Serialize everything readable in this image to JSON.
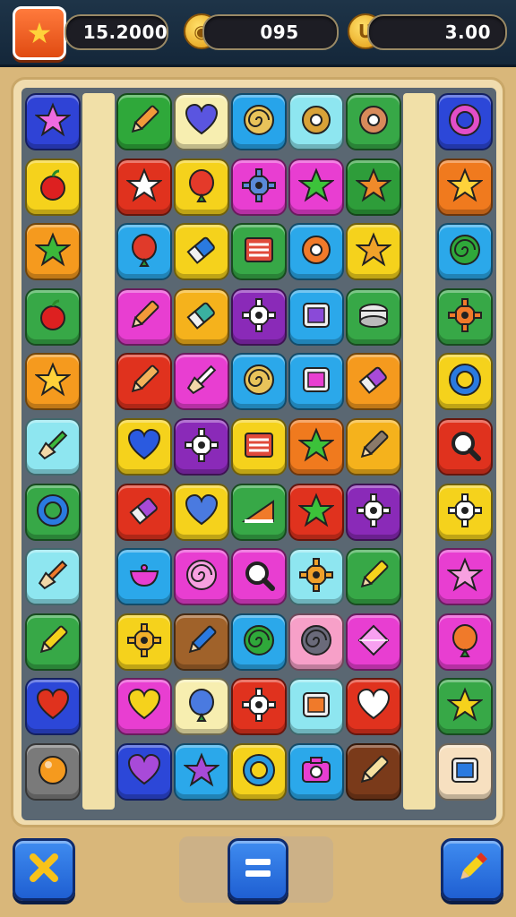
{
  "header": {
    "stars_value": "15.2000",
    "coins_value": "095",
    "gold_value": "3.00",
    "stars_icon": "star-icon",
    "coins_icon": "coin-icon",
    "gold_icon": "gold-coin-icon"
  },
  "board": {
    "rows": 11,
    "tiles": [
      [
        {
          "c": "#2f43d6",
          "i": "star",
          "f": "#f06be0"
        },
        null,
        {
          "c": "#2fa83a",
          "i": "pencil",
          "f": "#f29a3a"
        },
        {
          "c": "#f7eeb0",
          "i": "heart",
          "f": "#5a55e0"
        },
        {
          "c": "#27a4ea",
          "i": "swirl",
          "f": "#e8c35a"
        },
        {
          "c": "#8ee6f0",
          "i": "donut",
          "f": "#d8a238"
        },
        {
          "c": "#37a847",
          "i": "donut",
          "f": "#d88a5a"
        },
        null,
        {
          "c": "#2c47d8",
          "i": "ring",
          "f": "#e24ec8"
        }
      ],
      [
        {
          "c": "#f5d21c",
          "i": "apple",
          "f": "#dd2020"
        },
        null,
        {
          "c": "#e0321e",
          "i": "star",
          "f": "#ffffff"
        },
        {
          "c": "#f5d21c",
          "i": "balloon",
          "f": "#e43a2a"
        },
        {
          "c": "#e83ed1",
          "i": "gear",
          "f": "#5a8ad8"
        },
        {
          "c": "#e83ed1",
          "i": "star",
          "f": "#3cc23a"
        },
        {
          "c": "#2e9d3a",
          "i": "star",
          "f": "#f08a2a"
        },
        null,
        {
          "c": "#f07a1e",
          "i": "star",
          "f": "#ffd23a"
        }
      ],
      [
        {
          "c": "#f59a1e",
          "i": "star",
          "f": "#3cb83a"
        },
        null,
        {
          "c": "#2ba8ea",
          "i": "balloon",
          "f": "#e03a2a"
        },
        {
          "c": "#f5d21c",
          "i": "eraser",
          "f": "#2a7ae0"
        },
        {
          "c": "#37a847",
          "i": "book",
          "f": "#e04a3a"
        },
        {
          "c": "#2ba8ea",
          "i": "donut",
          "f": "#f07a2a"
        },
        {
          "c": "#f5d21c",
          "i": "star",
          "f": "#f0a22a"
        },
        null,
        {
          "c": "#2ba8ea",
          "i": "swirl",
          "f": "#2fa83a"
        }
      ],
      [
        {
          "c": "#37a847",
          "i": "apple",
          "f": "#dd2020"
        },
        null,
        {
          "c": "#e83ed1",
          "i": "pencil",
          "f": "#f29a3a"
        },
        {
          "c": "#f5b21c",
          "i": "eraser",
          "f": "#3ab0a0"
        },
        {
          "c": "#8a2ab8",
          "i": "gear",
          "f": "#ffffff"
        },
        {
          "c": "#2ba8ea",
          "i": "box",
          "f": "#8a4ad8"
        },
        {
          "c": "#37a847",
          "i": "cake",
          "f": "#e8e8e8"
        },
        null,
        {
          "c": "#37a847",
          "i": "gear",
          "f": "#f07a2a"
        }
      ],
      [
        {
          "c": "#f59a1e",
          "i": "star",
          "f": "#ffd23a"
        },
        null,
        {
          "c": "#e0321e",
          "i": "pencil",
          "f": "#f2b25a"
        },
        {
          "c": "#e83ed1",
          "i": "brush",
          "f": "#ffffff"
        },
        {
          "c": "#2ba8ea",
          "i": "swirl",
          "f": "#e8c35a"
        },
        {
          "c": "#2ba8ea",
          "i": "box",
          "f": "#e83ed1"
        },
        {
          "c": "#f59a1e",
          "i": "eraser",
          "f": "#a84ad8"
        },
        null,
        {
          "c": "#f5d21c",
          "i": "ring",
          "f": "#2a7ae0"
        }
      ],
      [
        {
          "c": "#8ee6f0",
          "i": "brush",
          "f": "#3cb83a"
        },
        null,
        {
          "c": "#f5d21c",
          "i": "heart",
          "f": "#2a5ae0"
        },
        {
          "c": "#8a2ab8",
          "i": "gear",
          "f": "#ffffff"
        },
        {
          "c": "#f5d21c",
          "i": "book",
          "f": "#e04a3a"
        },
        {
          "c": "#f07a1e",
          "i": "star",
          "f": "#3cc23a"
        },
        {
          "c": "#f5b21c",
          "i": "pencil",
          "f": "#8a7a6a"
        },
        null,
        {
          "c": "#e0321e",
          "i": "magnifier",
          "f": "#ffffff"
        }
      ],
      [
        {
          "c": "#37a847",
          "i": "ring",
          "f": "#2a7ae0"
        },
        null,
        {
          "c": "#e0321e",
          "i": "eraser",
          "f": "#a84ad8"
        },
        {
          "c": "#f5d21c",
          "i": "heart",
          "f": "#4a7ae0"
        },
        {
          "c": "#37a847",
          "i": "wedge",
          "f": "#f07a2a"
        },
        {
          "c": "#e0321e",
          "i": "star",
          "f": "#3cc23a"
        },
        {
          "c": "#8a2ab8",
          "i": "gear",
          "f": "#ffffff"
        },
        null,
        {
          "c": "#f5d21c",
          "i": "gear",
          "f": "#ffffff"
        }
      ],
      [
        {
          "c": "#8ee6f0",
          "i": "brush",
          "f": "#f07a2a"
        },
        null,
        {
          "c": "#2ba8ea",
          "i": "bowl",
          "f": "#e83ed1"
        },
        {
          "c": "#e83ed1",
          "i": "swirl",
          "f": "#f7a0e0"
        },
        {
          "c": "#e83ed1",
          "i": "magnifier",
          "f": "#ffffff"
        },
        {
          "c": "#8ee6f0",
          "i": "gear",
          "f": "#f0a02a"
        },
        {
          "c": "#37a847",
          "i": "pencil",
          "f": "#f5d21c"
        },
        null,
        {
          "c": "#e83ed1",
          "i": "star",
          "f": "#f7a0e0"
        }
      ],
      [
        {
          "c": "#37a847",
          "i": "pencil",
          "f": "#f5d21c"
        },
        null,
        {
          "c": "#f5d21c",
          "i": "gear",
          "f": "#f0b02a"
        },
        {
          "c": "#a0622a",
          "i": "pencil",
          "f": "#2a7ae0"
        },
        {
          "c": "#2ba8ea",
          "i": "swirl",
          "f": "#2fa83a"
        },
        {
          "c": "#f7a0c8",
          "i": "swirl",
          "f": "#6a6a7a"
        },
        {
          "c": "#e83ed1",
          "i": "gem",
          "f": "#f7a0f0"
        },
        null,
        {
          "c": "#e83ed1",
          "i": "balloon",
          "f": "#f07a2a"
        }
      ],
      [
        {
          "c": "#2c47d8",
          "i": "heart",
          "f": "#e0321e"
        },
        null,
        {
          "c": "#e83ed1",
          "i": "heart",
          "f": "#f5d21c"
        },
        {
          "c": "#f7eeb0",
          "i": "balloon",
          "f": "#4a7ae0"
        },
        {
          "c": "#e0321e",
          "i": "gear",
          "f": "#ffffff"
        },
        {
          "c": "#8ee6f0",
          "i": "box",
          "f": "#f07a2a"
        },
        {
          "c": "#e0321e",
          "i": "heart",
          "f": "#ffffff"
        },
        null,
        {
          "c": "#37a847",
          "i": "star",
          "f": "#f5d21c"
        }
      ],
      [
        {
          "c": "#7a7a7a",
          "i": "orb",
          "f": "#f59a1e"
        },
        null,
        {
          "c": "#2c47d8",
          "i": "heart",
          "f": "#a84ad8"
        },
        {
          "c": "#2ba8ea",
          "i": "star",
          "f": "#a84ad8"
        },
        {
          "c": "#f5d21c",
          "i": "ring",
          "f": "#2a9ae0"
        },
        {
          "c": "#2ba8ea",
          "i": "camera",
          "f": "#e83ed1"
        },
        {
          "c": "#7a3a1a",
          "i": "pencil",
          "f": "#f5e0a0"
        },
        null,
        {
          "c": "#f7e0c0",
          "i": "box",
          "f": "#2a7ae0"
        }
      ]
    ]
  },
  "footer": {
    "left_button_icon": "close-icon",
    "center_button_icon": "menu-icon",
    "right_button_icon": "pencil-icon"
  }
}
